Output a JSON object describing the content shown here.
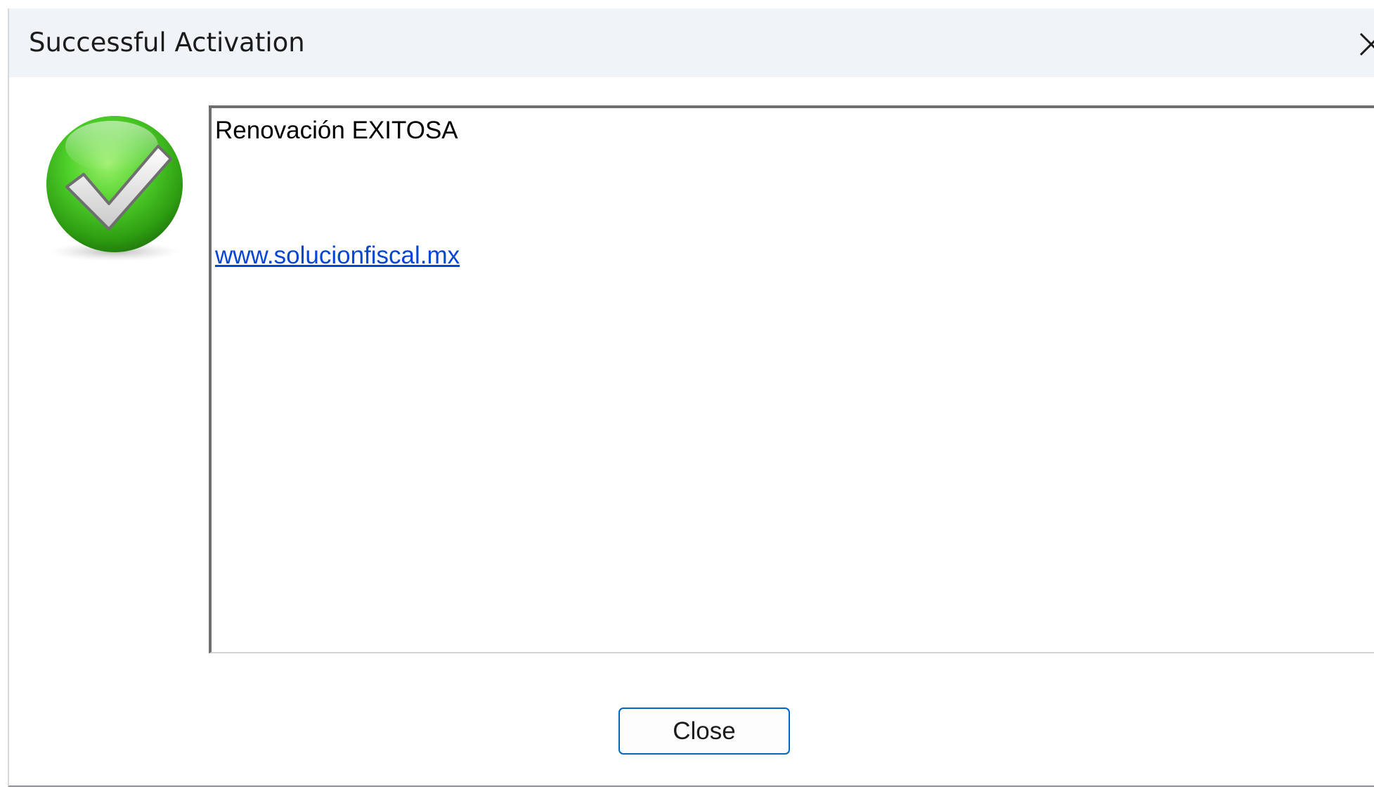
{
  "window": {
    "title": "Successful Activation",
    "close_icon": "close-x-icon"
  },
  "icon": {
    "name": "success-checkmark-icon",
    "color": "#3fbf1f"
  },
  "message": {
    "line1": "Renovación EXITOSA",
    "link": "www.solucionfiscal.mx",
    "link_color": "#0645d6"
  },
  "buttons": {
    "close_label": "Close",
    "accent": "#0067c0"
  }
}
